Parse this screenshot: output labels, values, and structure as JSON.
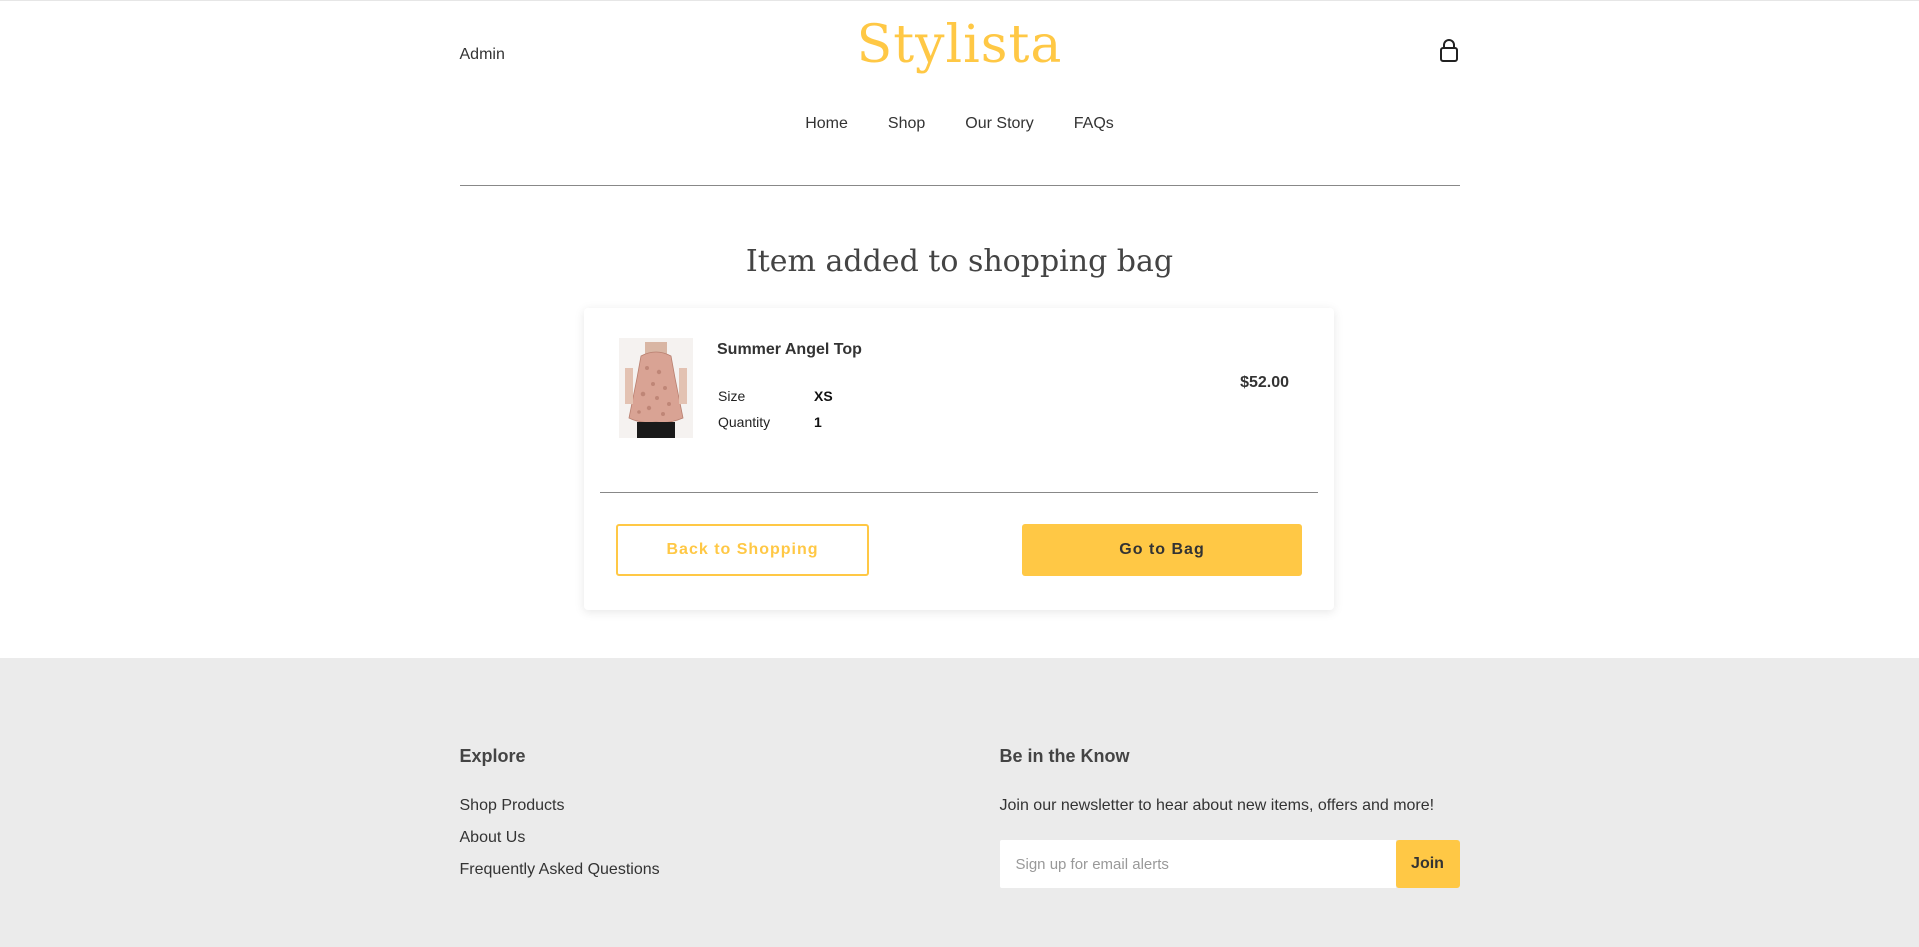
{
  "header": {
    "admin_label": "Admin",
    "logo_text": "Stylista",
    "nav": [
      {
        "label": "Home"
      },
      {
        "label": "Shop"
      },
      {
        "label": "Our Story"
      },
      {
        "label": "FAQs"
      }
    ]
  },
  "confirmation": {
    "title": "Item added to shopping bag",
    "item": {
      "name": "Summer Angel Top",
      "size_label": "Size",
      "size_value": "XS",
      "quantity_label": "Quantity",
      "quantity_value": "1",
      "price": "$52.00"
    },
    "back_button": "Back to Shopping",
    "go_button": "Go to Bag"
  },
  "footer": {
    "explore_title": "Explore",
    "explore_links": [
      {
        "label": "Shop Products"
      },
      {
        "label": "About Us"
      },
      {
        "label": "Frequently Asked Questions"
      }
    ],
    "newsletter_title": "Be in the Know",
    "newsletter_text": "Join our newsletter to hear about new items, offers and more!",
    "newsletter_placeholder": "Sign up for email alerts",
    "newsletter_button": "Join"
  },
  "colors": {
    "accent": "#ffc845",
    "footer_bg": "#ebebeb",
    "text": "#333333"
  },
  "icons": {
    "bag": "shopping-bag-icon"
  }
}
